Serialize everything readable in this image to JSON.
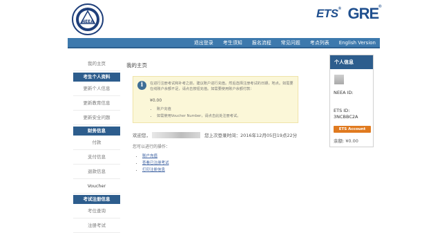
{
  "brand": {
    "ets": "ETS",
    "gre": "GRE",
    "neea_logo_text": "NEEA"
  },
  "nav": [
    "退出登录",
    "考生须知",
    "报名流程",
    "常见问题",
    "考点列表",
    "English Version"
  ],
  "sidebar": {
    "top_item": "我的主页",
    "groups": [
      {
        "heading": "考生个人资料",
        "items": [
          "更新个人信息",
          "更新教育信息",
          "更新安全问题"
        ]
      },
      {
        "heading": "财务信息",
        "items": [
          "付款",
          "支付信息",
          "退款信息",
          "Voucher"
        ]
      },
      {
        "heading": "考试注册信息",
        "items": [
          "考位查询",
          "注册考试"
        ]
      }
    ]
  },
  "main": {
    "title": "我的主页",
    "notice": {
      "text": "在进行注册考试和补考之前，建议账户进行充值。然后选择注册考试的日期，地点。如需要在线账户余额不足，请点击按钮充值。如需要使用账户余额付款：",
      "balance": "¥0.00",
      "list": [
        "账户充值",
        "如需使用Voucher Number，请点击此处注册考试。"
      ]
    },
    "welcome_prefix": "欢迎您，",
    "last_login": "您上次登录时间：2016年12月05日19点22分",
    "ops_title": "您可以进行的操作：",
    "links": [
      "账户充值",
      "查看已注册考试",
      "打印注册信息"
    ]
  },
  "info_panel": {
    "title": "个人信息",
    "neea_id": "NEEA ID:",
    "ets_id_label": "ETS ID:",
    "ets_id_value": "3NCBBC2A",
    "ets_account_button": "ETS Account",
    "balance": "余额: ¥0.00"
  },
  "colors": {
    "nav_bg": "#3d79ad",
    "sidebar_head_bg": "#2d5d8d",
    "notice_bg": "#fbf7d8",
    "ets_account_btn": "#e07a1f"
  }
}
